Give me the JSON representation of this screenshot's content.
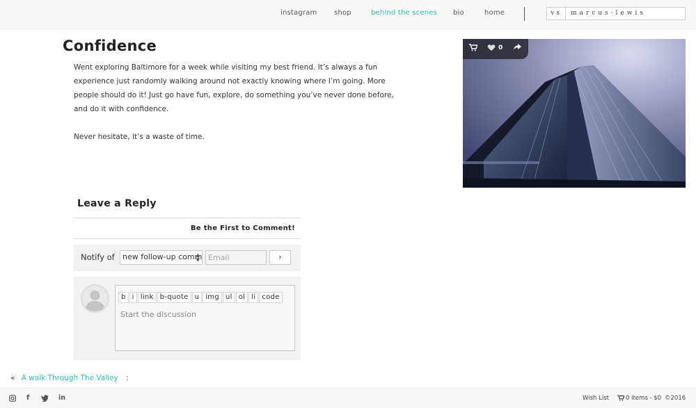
{
  "nav": {
    "links": [
      {
        "label": "instagram",
        "active": false
      },
      {
        "label": "shop",
        "active": false
      },
      {
        "label": "behind the scenes",
        "active": true
      },
      {
        "label": "bio",
        "active": false
      },
      {
        "label": "home",
        "active": false
      }
    ],
    "logo_prefix": "vs",
    "logo_name": "marcus·lewis",
    "accent_color": "#2fbfb4"
  },
  "post": {
    "title": "Confidence",
    "paragraphs": [
      "Went exploring Baltimore for a week while visiting my best friend. It’s always a fun experience just randomly walking around not exactly knowing where I’m going. More people should do it! Just go have fun, explore, do something you’ve never done before, and do it with confidence.",
      "Never hesitate, it’s a waste of time."
    ]
  },
  "photo": {
    "like_count": "0",
    "icons": [
      "cart-icon",
      "heart-icon",
      "share-icon"
    ]
  },
  "comments": {
    "title": "Leave a Reply",
    "first_comment": "Be the First to Comment!",
    "notify_label": "Notify of",
    "notify_selected": "new follow-up comments",
    "email_placeholder": "Email",
    "submit_label": "›",
    "tools": [
      "b",
      "i",
      "link",
      "b-quote",
      "u",
      "img",
      "ul",
      "ol",
      "li",
      "code"
    ],
    "discussion_placeholder": "Start the discussion"
  },
  "post_nav": {
    "prev_symbol": "«",
    "prev_title": "A walk Through The Valley",
    "separator": ":"
  },
  "footer": {
    "social_icons": [
      "instagram-icon",
      "facebook-icon",
      "twitter-icon",
      "linkedin-icon"
    ],
    "wish_list": "Wish List",
    "cart": "0 items - $0",
    "copyright": "©2016"
  }
}
